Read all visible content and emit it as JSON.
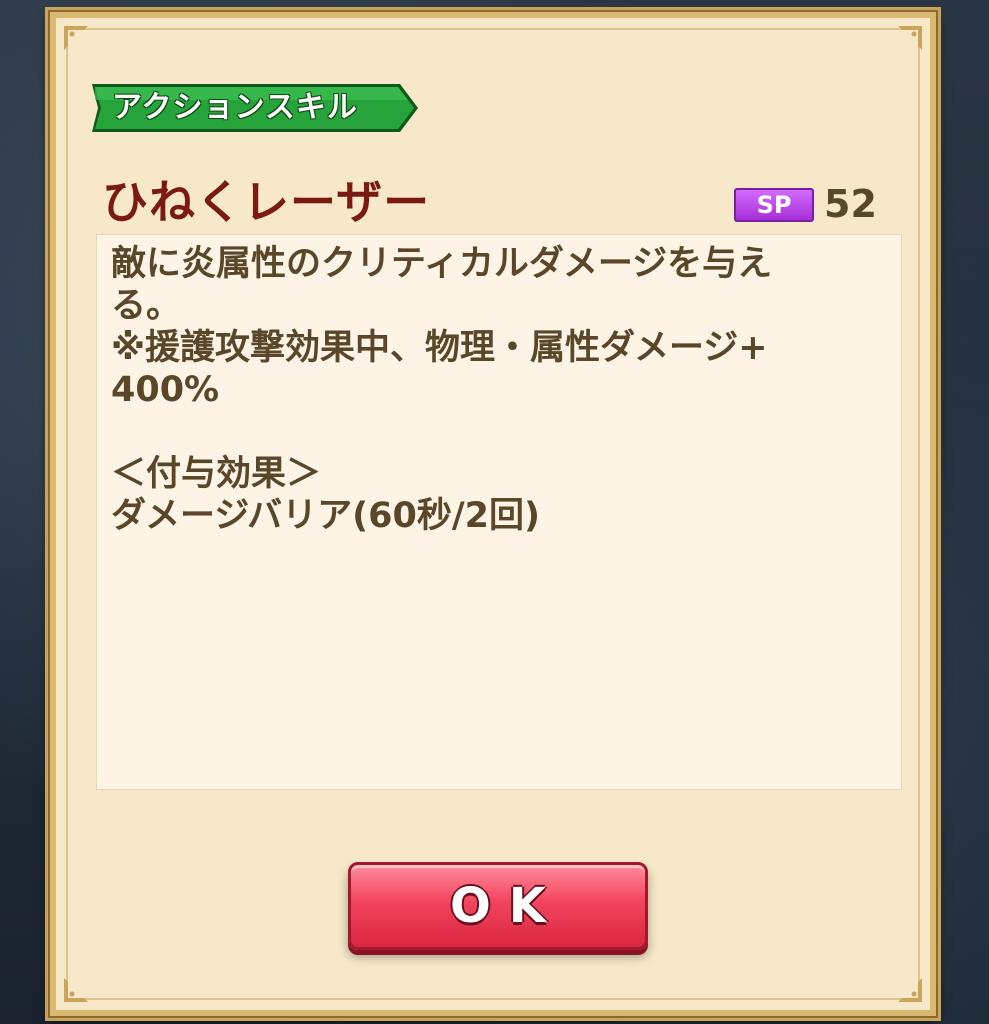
{
  "dialog": {
    "skill_type": "アクションスキル",
    "skill_name": "ひねくレーザー",
    "sp": {
      "label": "SP",
      "value": "52"
    },
    "description_lines": [
      "敵に炎属性のクリティカルダメージを与え",
      "る。",
      "※援護攻撃効果中、物理・属性ダメージ+",
      "400%",
      "",
      "＜付与効果＞",
      "ダメージバリア(60秒/2回)"
    ],
    "ok_label": "OK"
  },
  "colors": {
    "panel": "#f6e8c8",
    "tag_green": "#1f8a2e",
    "skill_name": "#7a1a10",
    "sp_purple": "#b63ee6",
    "text_brown": "#5a4628",
    "ok_red": "#f2445e"
  }
}
